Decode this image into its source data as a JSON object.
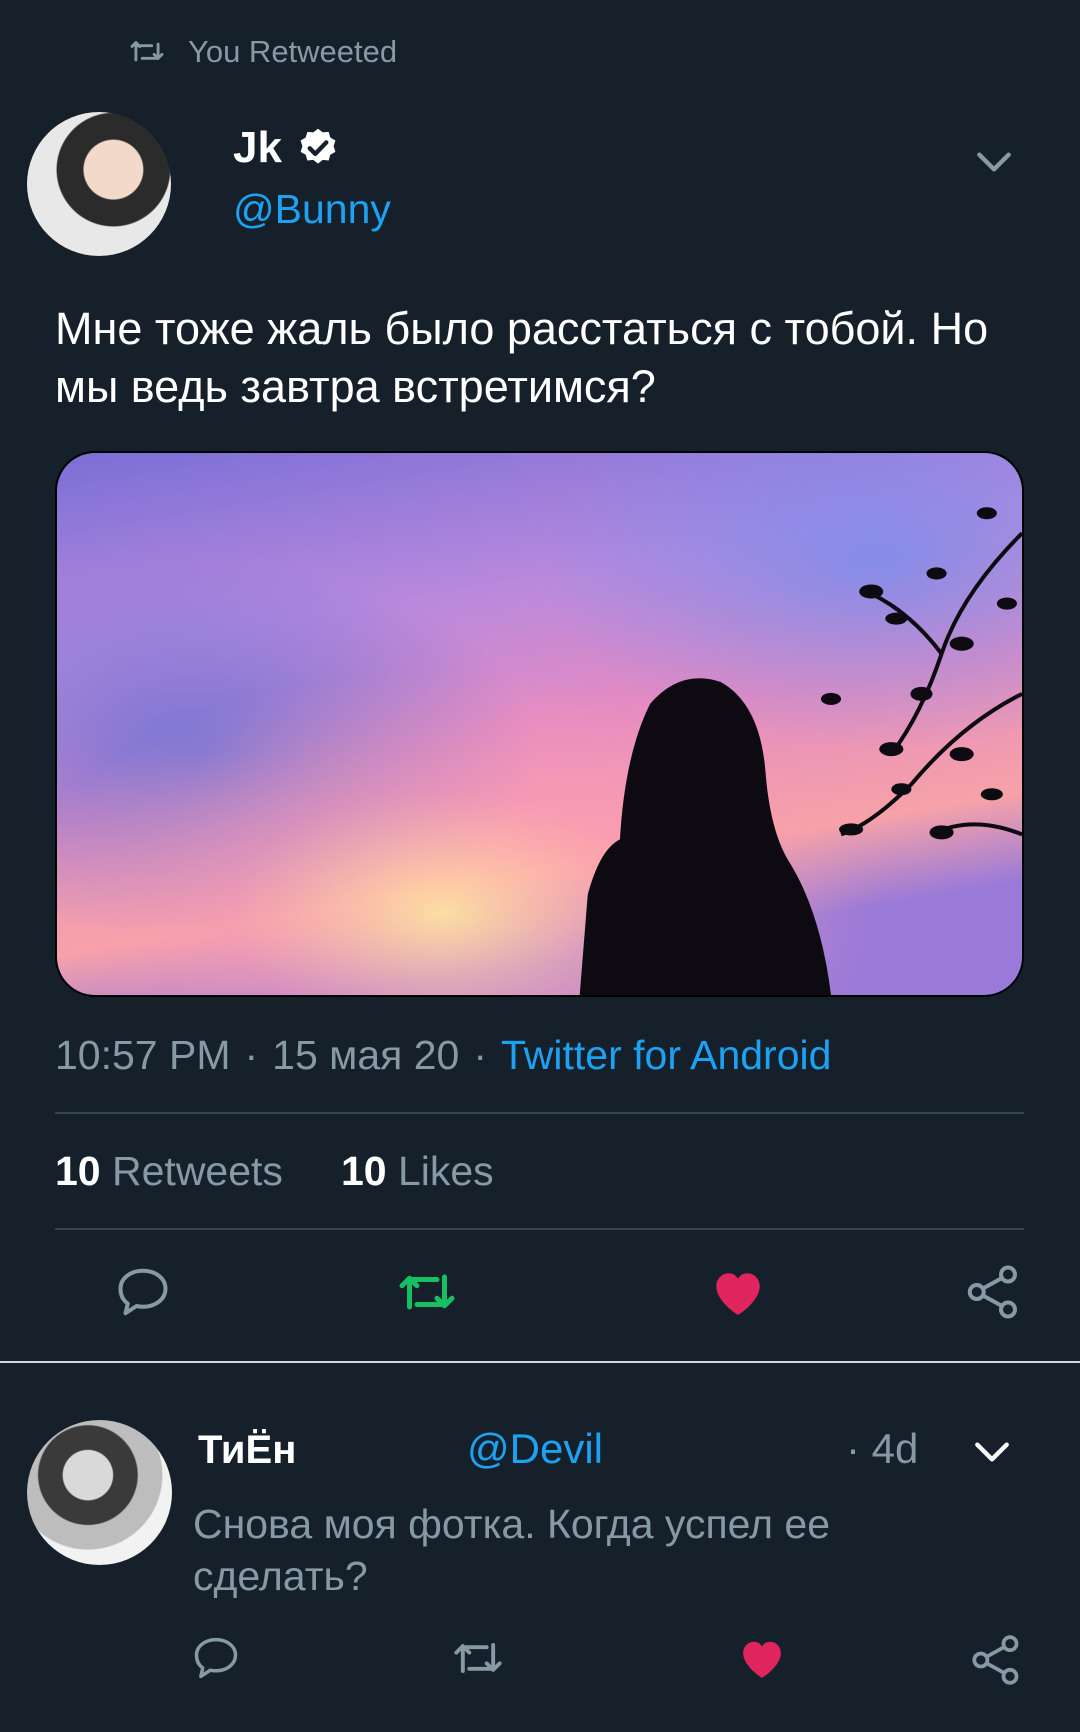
{
  "retweet_header": {
    "label": "You Retweeted",
    "icon": "retweet-icon"
  },
  "tweet": {
    "author_name": "Jk",
    "author_handle": "@Bunny",
    "verified_icon": "verified-badge-icon",
    "text": "Мне тоже жаль было расстаться с тобой. Но мы ведь завтра встретимся?",
    "time": "10:57 PM",
    "date": "15 мая 20",
    "source": "Twitter for Android",
    "separator": "·",
    "stats": {
      "retweets_count": "10",
      "retweets_label": "Retweets",
      "likes_count": "10",
      "likes_label": "Likes"
    },
    "actions": [
      "reply-icon",
      "retweet-icon",
      "like-icon",
      "share-icon"
    ]
  },
  "reply": {
    "author_name": "ТиЁн",
    "author_handle": "@Devil",
    "time": "· 4d",
    "text": "Снова моя фотка. Когда успел ее сделать?",
    "actions": [
      "reply-icon",
      "retweet-icon",
      "like-icon",
      "share-icon"
    ]
  },
  "colors": {
    "background": "#15202b",
    "accent_blue": "#1da1f2",
    "retweet_green": "#17bf63",
    "like_red": "#e0245e",
    "muted": "#8899a6"
  }
}
